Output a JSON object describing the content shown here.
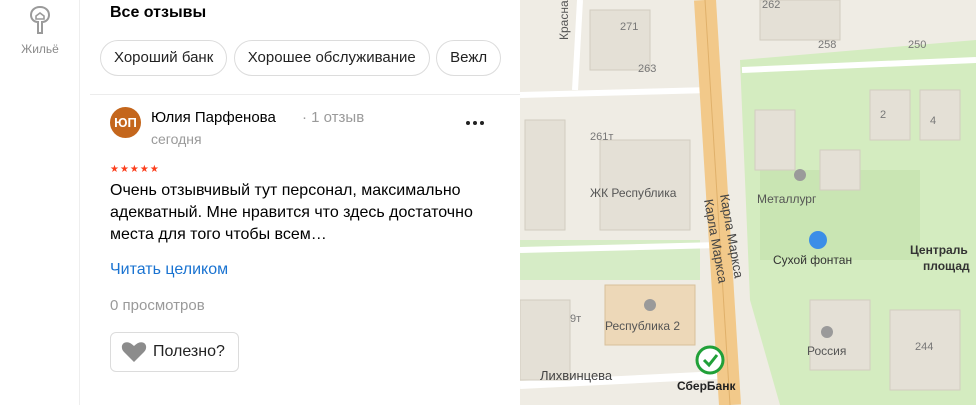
{
  "rail": {
    "housing_label": "Жильё",
    "housing_icon": "tree-house-icon"
  },
  "reviews": {
    "title": "Все отзывы",
    "chips": [
      "Хороший банк",
      "Хорошее обслуживание",
      "Вежл"
    ],
    "review": {
      "avatar_initials": "ЮП",
      "avatar_color": "#c4661c",
      "author": "Юлия Парфенова",
      "count": "· 1 отзыв",
      "date": "сегодня",
      "stars": "★★★★★",
      "rating": 5,
      "text": "Очень отзывчивый тут персонал, максимально адекватный. Мне нравится что здесь достаточно места для того чтобы всем…",
      "read_more": "Читать целиком",
      "views": "0 просмотров",
      "useful_label": "Полезно?"
    }
  },
  "map": {
    "streets": {
      "krasnaya": "Красная",
      "karla_marksa_1": "Карла Маркса",
      "karla_marksa_2": "Карла Маркса",
      "likhvintseva": "Лихвинцева"
    },
    "house_numbers": {
      "n271": "271",
      "n263": "263",
      "n261t": "261т",
      "n262": "262",
      "n258": "258",
      "n250": "250",
      "n2": "2",
      "n4": "4",
      "n9t": "9т",
      "n244": "244"
    },
    "places": {
      "zhk": "ЖК Республика",
      "metallurg": "Металлург",
      "fountain": "Сухой фонтан",
      "square_1": "Централь",
      "square_2": "площад",
      "respublika2": "Республика 2",
      "rossiya": "Россия",
      "sberbank": "СберБанк"
    },
    "colors": {
      "road": "#f2c98a",
      "park": "#c7e6b1",
      "block": "#eae6dc",
      "sber": "#21a038",
      "poi": "#9a9a9a"
    }
  }
}
